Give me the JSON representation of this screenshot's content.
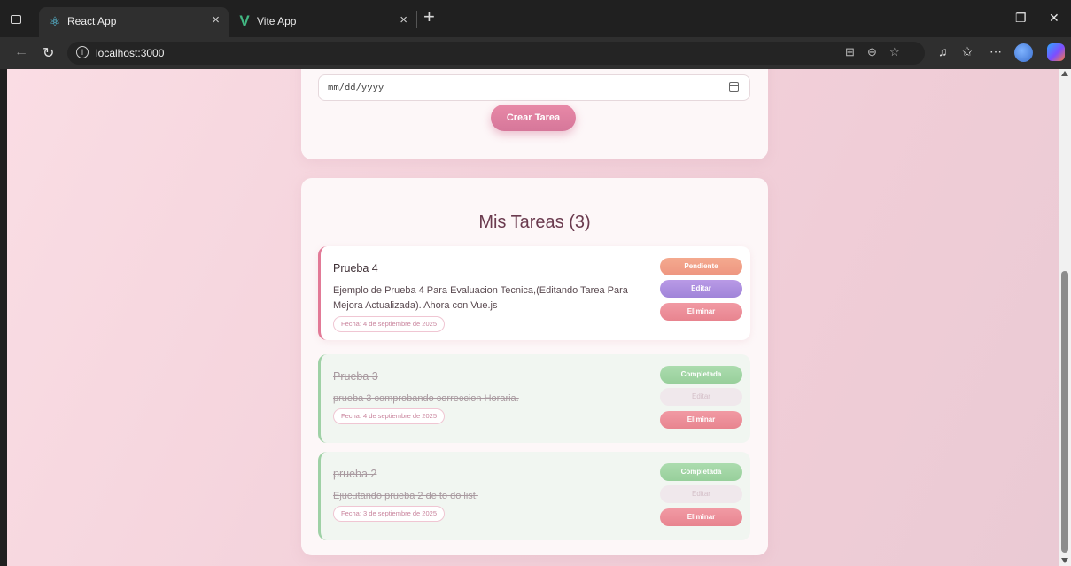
{
  "browser": {
    "tabs": [
      {
        "title": "React App",
        "active": true
      },
      {
        "title": "Vite App",
        "active": false
      }
    ],
    "url": "localhost:3000"
  },
  "form": {
    "date_value": "mm/dd/yyyy",
    "submit_label": "Crear Tarea"
  },
  "list": {
    "title": "Mis Tareas (3)",
    "tasks": [
      {
        "title": "Prueba 4",
        "description": "Ejemplo de Prueba 4 Para Evaluacion Tecnica,(Editando Tarea Para Mejora Actualizada). Ahora con Vue.js",
        "date": "Fecha: 4 de septiembre de 2025",
        "status_label": "Pendiente",
        "edit_label": "Editar",
        "delete_label": "Eliminar",
        "completed": false
      },
      {
        "title": "Prueba 3",
        "description": "prueba 3 comprobando correccion Horaria.",
        "date": "Fecha: 4 de septiembre de 2025",
        "status_label": "Completada",
        "edit_label": "Editar",
        "delete_label": "Eliminar",
        "completed": true
      },
      {
        "title": "prueba 2",
        "description": "Ejucutando prueba 2 de to do list.",
        "date": "Fecha: 3 de septiembre de 2025",
        "status_label": "Completada",
        "edit_label": "Editar",
        "delete_label": "Eliminar",
        "completed": true
      }
    ]
  },
  "colors": {
    "accent": "#e27a97",
    "pending": "#f4aa8f",
    "edit": "#a084d9",
    "delete": "#e8848f",
    "completed": "#97cf9b"
  }
}
